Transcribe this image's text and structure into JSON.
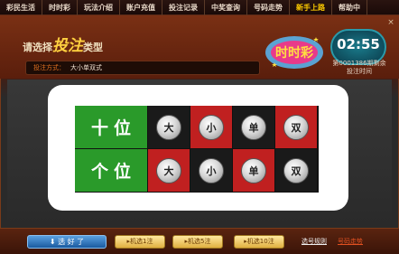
{
  "nav": {
    "items": [
      "彩民生活",
      "时时彩",
      "玩法介绍",
      "账户充值",
      "投注记录",
      "中奖查询",
      "号码走势",
      "新手上路",
      "帮助中"
    ],
    "active_index": 7
  },
  "header": {
    "title_prefix": "请选择",
    "title_big": "投注",
    "title_suffix": "类型",
    "close_label": "×"
  },
  "method": {
    "label": "投注方式：",
    "value": "大小单双式"
  },
  "logo": {
    "text": "时时彩"
  },
  "timer": {
    "countdown": "02:55",
    "period_line1": "第0001386期剩余",
    "period_line2": "投注时间"
  },
  "grid": {
    "rows": [
      {
        "position": [
          "十",
          "位"
        ],
        "options": [
          "大",
          "小",
          "单",
          "双"
        ]
      },
      {
        "position": [
          "个",
          "位"
        ],
        "options": [
          "大",
          "小",
          "单",
          "双"
        ]
      }
    ]
  },
  "bottom": {
    "select_button": "选 好 了",
    "random1": "机选1注",
    "random5": "机选5注",
    "random10": "机选10注",
    "rules_link": "选号规则",
    "trend_link": "号码走势"
  },
  "colors": {
    "green": "#2a9a2a",
    "red": "#c02020",
    "dark": "#1a1a1a",
    "accent": "#ffcc00"
  }
}
